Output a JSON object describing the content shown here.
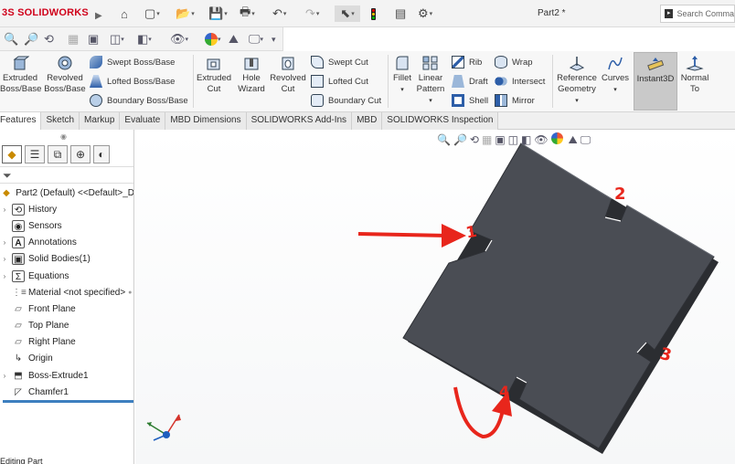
{
  "app": {
    "logo_text": "SOLIDWORKS",
    "doc_title": "Part2 *",
    "search_placeholder": "Search Comma"
  },
  "quick_toolbar": [
    {
      "icon": "home-icon"
    },
    {
      "icon": "new-document-icon"
    },
    {
      "icon": "open-icon"
    },
    {
      "icon": "save-icon"
    },
    {
      "icon": "print-icon"
    },
    {
      "icon": "undo-icon"
    },
    {
      "icon": "redo-icon"
    },
    {
      "icon": "select-icon"
    },
    {
      "icon": "rebuild-icon"
    },
    {
      "icon": "file-properties-icon"
    },
    {
      "icon": "options-icon"
    }
  ],
  "ribbon": {
    "extruded_boss": "Extruded\nBoss/Base",
    "revolved_boss": "Revolved\nBoss/Base",
    "swept_boss": "Swept Boss/Base",
    "lofted_boss": "Lofted Boss/Base",
    "boundary_boss": "Boundary Boss/Base",
    "extruded_cut": "Extruded\nCut",
    "hole_wizard": "Hole\nWizard",
    "revolved_cut": "Revolved\nCut",
    "swept_cut": "Swept Cut",
    "lofted_cut": "Lofted Cut",
    "boundary_cut": "Boundary Cut",
    "fillet": "Fillet",
    "linear_pattern": "Linear\nPattern",
    "rib": "Rib",
    "draft": "Draft",
    "shell": "Shell",
    "wrap": "Wrap",
    "intersect": "Intersect",
    "mirror": "Mirror",
    "reference_geometry": "Reference\nGeometry",
    "curves": "Curves",
    "instant3d": "Instant3D",
    "normal_to": "Normal\nTo"
  },
  "tabs": [
    {
      "label": "Features",
      "active": true
    },
    {
      "label": "Sketch"
    },
    {
      "label": "Markup"
    },
    {
      "label": "Evaluate"
    },
    {
      "label": "MBD Dimensions"
    },
    {
      "label": "SOLIDWORKS Add-Ins"
    },
    {
      "label": "MBD"
    },
    {
      "label": "SOLIDWORKS Inspection"
    }
  ],
  "tree": {
    "root": "Part2 (Default) <<Default>_D",
    "items": [
      {
        "label": "History",
        "icon": "history-icon"
      },
      {
        "label": "Sensors",
        "icon": "sensors-icon"
      },
      {
        "label": "Annotations",
        "icon": "annotations-icon"
      },
      {
        "label": "Solid Bodies(1)",
        "icon": "solid-bodies-icon"
      },
      {
        "label": "Equations",
        "icon": "equations-icon"
      },
      {
        "label": "Material <not specified>",
        "icon": "material-icon"
      },
      {
        "label": "Front Plane",
        "icon": "plane-icon"
      },
      {
        "label": "Top Plane",
        "icon": "plane-icon"
      },
      {
        "label": "Right Plane",
        "icon": "plane-icon"
      },
      {
        "label": "Origin",
        "icon": "origin-icon"
      },
      {
        "label": "Boss-Extrude1",
        "icon": "extrude-icon"
      },
      {
        "label": "Chamfer1",
        "icon": "chamfer-icon"
      }
    ]
  },
  "annotations": {
    "label_1": "1",
    "label_2": "2",
    "label_3": "3",
    "label_4": "4"
  },
  "colors": {
    "part_fill": "#4a4d54",
    "annotation_red": "#e8261c",
    "brand_red": "#d0021b",
    "tree_accent": "#3d7fbf"
  },
  "status": {
    "left_text": "Editing Part"
  }
}
